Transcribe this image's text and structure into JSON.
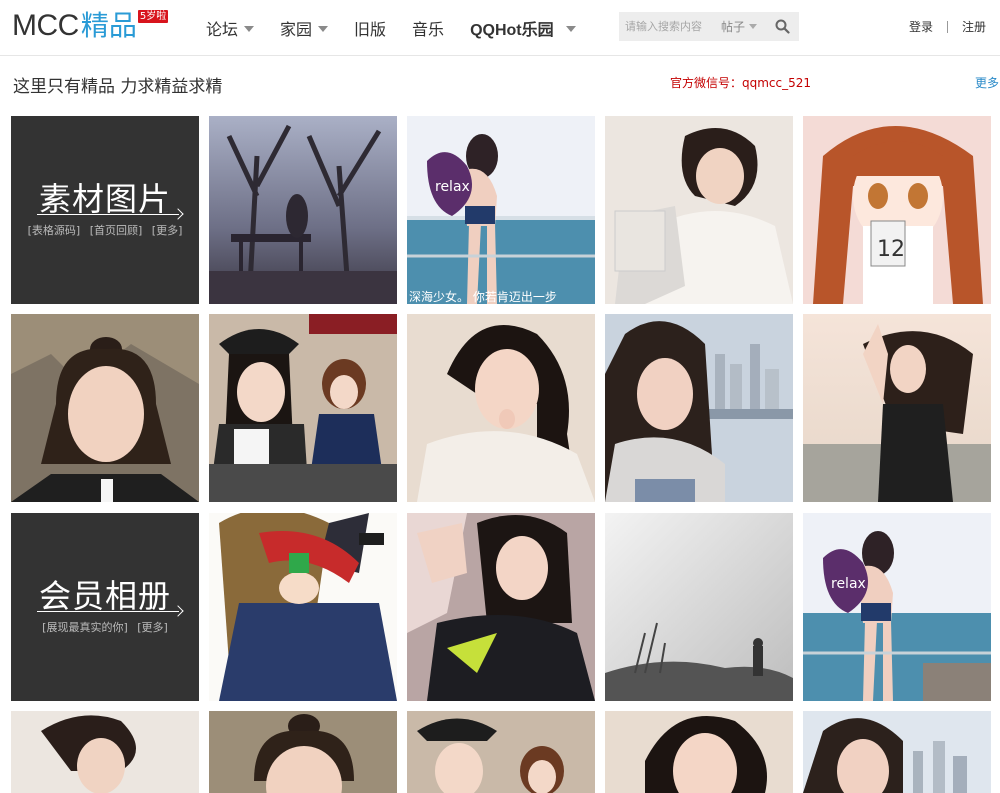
{
  "header": {
    "logo_text": "MCC",
    "logo_highlight": "精品",
    "logo_badge": "5岁啦",
    "nav": [
      {
        "label": "论坛",
        "dropdown": true
      },
      {
        "label": "家园",
        "dropdown": true
      },
      {
        "label": "旧版",
        "dropdown": false
      },
      {
        "label": "音乐",
        "dropdown": false
      },
      {
        "label": "QQHot乐园",
        "dropdown": true
      }
    ],
    "search": {
      "placeholder": "请输入搜索内容",
      "type": "帖子",
      "button_icon": "search-icon"
    },
    "login": "登录",
    "register": "注册"
  },
  "subheader": {
    "slogan": "这里只有精品 力求精益求精",
    "wechat": "官方微信号：qqmcc_521",
    "more": "更多"
  },
  "categories": [
    {
      "title": "素材图片",
      "links": [
        "[表格源码]",
        "[首页回顾]",
        "[更多]"
      ]
    },
    {
      "title": "会员相册",
      "links": [
        "[展现最真实的你]",
        "[更多]"
      ]
    }
  ],
  "caption": "深海少女。 你若肯迈出一步",
  "colors": {
    "accent": "#2a9bd6",
    "badge": "#d8141d",
    "wechat": "#c40000",
    "tile_dark": "#333333"
  }
}
